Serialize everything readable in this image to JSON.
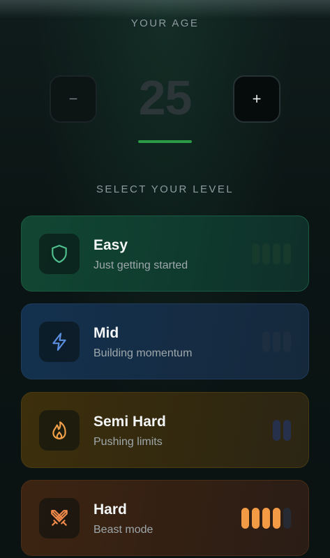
{
  "age": {
    "title": "YOUR AGE",
    "value": "25",
    "decrement_label": "−",
    "increment_label": "+"
  },
  "levels": {
    "title": "SELECT YOUR LEVEL",
    "items": [
      {
        "name": "Easy",
        "subtitle": "Just getting started",
        "icon": "shield-icon",
        "accent": "#4fc08d",
        "bars_total": 4,
        "bars_filled": 0
      },
      {
        "name": "Mid",
        "subtitle": "Building momentum",
        "icon": "lightning-icon",
        "accent": "#5b8ee0",
        "bars_total": 3,
        "bars_filled": 0
      },
      {
        "name": "Semi Hard",
        "subtitle": "Pushing limits",
        "icon": "flame-icon",
        "accent": "#f0a04a",
        "bars_total": 2,
        "bars_filled": 0
      },
      {
        "name": "Hard",
        "subtitle": "Beast mode",
        "icon": "crossed-swords-icon",
        "accent": "#f08a4a",
        "bars_total": 5,
        "bars_filled": 4
      }
    ],
    "selected": "Hard"
  },
  "colors": {
    "background": "#0b1414",
    "age_underline": "#2a9a47",
    "hard_bar_on": "#f39a45"
  }
}
